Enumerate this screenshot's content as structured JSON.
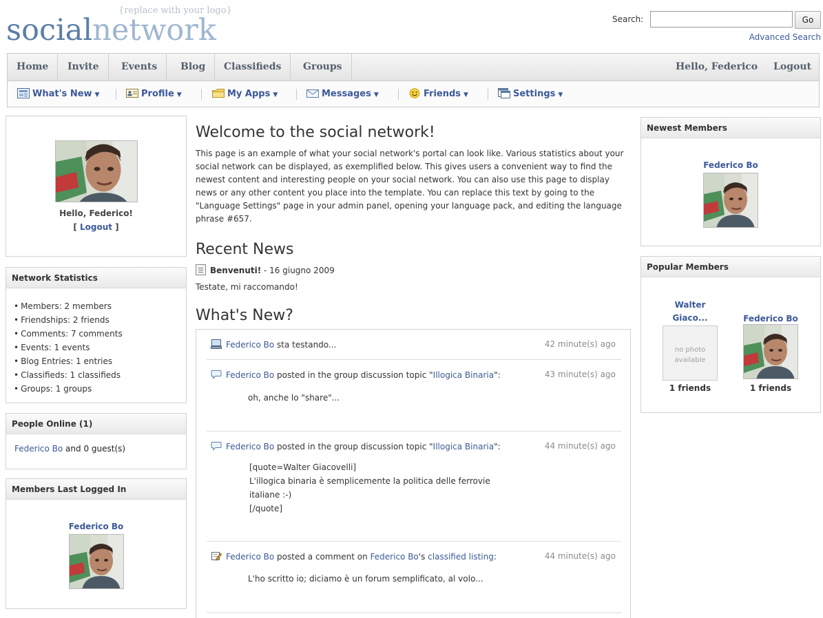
{
  "header": {
    "logo_tag": "{replace with your logo}",
    "logo_part1": "social",
    "logo_part2": "network",
    "search_label": "Search:",
    "search_value": "",
    "search_button": "Go",
    "advanced_search": "Advanced Search"
  },
  "topnav": {
    "items": [
      "Home",
      "Invite",
      "Events",
      "Blog",
      "Classifieds",
      "Groups"
    ],
    "greeting": "Hello, Federico",
    "logout": "Logout"
  },
  "subnav": {
    "items": [
      {
        "label": "What's New",
        "icon": "newspaper-icon"
      },
      {
        "label": "Profile",
        "icon": "id-card-icon"
      },
      {
        "label": "My Apps",
        "icon": "folder-icon"
      },
      {
        "label": "Messages",
        "icon": "envelope-icon"
      },
      {
        "label": "Friends",
        "icon": "smiley-icon"
      },
      {
        "label": "Settings",
        "icon": "window-icon"
      }
    ]
  },
  "profile": {
    "hello": "Hello, Federico!",
    "logout_open": "[ ",
    "logout": "Logout",
    "logout_close": " ]"
  },
  "stats": {
    "title": "Network Statistics",
    "items": [
      "Members: 2 members",
      "Friendships: 2 friends",
      "Comments: 7 comments",
      "Events: 1 events",
      "Blog Entries: 1 entries",
      "Classifieds: 1 classifieds",
      "Groups: 1 groups"
    ]
  },
  "online": {
    "title": "People Online (1)",
    "user": "Federico Bo",
    "rest": " and 0 guest(s)"
  },
  "last_logged": {
    "title": "Members Last Logged In",
    "name": "Federico Bo"
  },
  "main": {
    "welcome_title": "Welcome to the social network!",
    "welcome_body": "This page is an example of what your social network's portal can look like. Various statistics about your social network can be displayed, as exemplified below. This gives users a convenient way to find the newest content and interesting people on your social network. You can also use this page to display news or any other content you place into the template. You can replace this text by going to the \"Language Settings\" page in your admin panel, opening your language pack, and editing the language phrase #657.",
    "news_title": "Recent News",
    "news_headline": "Benvenuti!",
    "news_date": " - 16 giugno 2009",
    "news_body": "Testate, mi raccomando!",
    "whatsnew_title": "What's New?"
  },
  "feed": [
    {
      "icon": "computer-icon",
      "user": "Federico Bo",
      "action": " sta testando...",
      "time": "42 minute(s) ago",
      "body": []
    },
    {
      "icon": "speech-bubble-icon",
      "user": "Federico Bo",
      "action": " posted in the group discussion topic \"",
      "topic": "Illogica Binaria",
      "after": "\":",
      "time": "43 minute(s) ago",
      "body": [
        "oh, anche lo \"share\"..."
      ]
    },
    {
      "icon": "speech-bubble-icon",
      "user": "Federico Bo",
      "action": " posted in the group discussion topic \"",
      "topic": "Illogica Binaria",
      "after": "\":",
      "time": "44 minute(s) ago",
      "body": [
        "[quote=Walter Giacovelli]",
        "L'illogica binaria è semplicemente la politica delle ferrovie",
        "italiane :-)",
        "[/quote]"
      ]
    },
    {
      "icon": "pencil-note-icon",
      "user": "Federico Bo",
      "action": " posted a comment on ",
      "owner": "Federico Bo",
      "owner_suffix": "'s ",
      "link": "classified listing",
      "after": ":",
      "time": "44 minute(s) ago",
      "body": [
        "L'ho scritto io; diciamo è un forum semplificato, al volo..."
      ]
    }
  ],
  "newest": {
    "title": "Newest Members",
    "name": "Federico Bo"
  },
  "popular": {
    "title": "Popular Members",
    "members": [
      {
        "name_line1": "Walter",
        "name_line2": "Giaco...",
        "photo_text_1": "no photo",
        "photo_text_2": "available",
        "friends": "1 friends"
      },
      {
        "name_line1": "Federico Bo",
        "friends": "1 friends"
      }
    ]
  },
  "colors": {
    "link": "#3b5998",
    "logo_dark": "#5a7ea6",
    "logo_light": "#9fb6cf"
  }
}
